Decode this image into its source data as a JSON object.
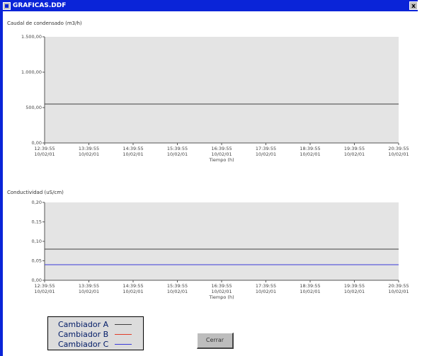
{
  "window": {
    "title": "GRAFICAS.DDF",
    "close_label": "x"
  },
  "colors": {
    "title_bar": "#0a24d8",
    "plot_bg": "#e4e4e4",
    "cambiador_a": "#404040",
    "cambiador_b": "#e03c28",
    "cambiador_c": "#3a3ad8"
  },
  "chart_data": [
    {
      "type": "line",
      "title": "Caudal de condensado (m3/h)",
      "xlabel": "Tiempo (h)",
      "ylabel": "",
      "ylim": [
        0,
        1500
      ],
      "yticks": [
        "0,00",
        "500,00",
        "1.000,00",
        "1.500,00"
      ],
      "ytick_values": [
        0,
        500,
        1000,
        1500
      ],
      "x": [
        "12:39:55",
        "13:39:55",
        "14:39:55",
        "15:39:55",
        "16:39:55",
        "17:39:55",
        "18:39:55",
        "19:39:55",
        "20:39:55"
      ],
      "xdate": "10/02/01",
      "grid": false,
      "series": [
        {
          "name": "Cambiador A",
          "values": [
            550,
            550,
            550,
            550,
            550,
            550,
            550,
            550,
            550
          ]
        }
      ]
    },
    {
      "type": "line",
      "title": "Conductividad (uS/cm)",
      "xlabel": "Tiempo (h)",
      "ylabel": "",
      "ylim": [
        0,
        0.2
      ],
      "yticks": [
        "0,00",
        "0,05",
        "0,10",
        "0,15",
        "0,20"
      ],
      "ytick_values": [
        0,
        0.05,
        0.1,
        0.15,
        0.2
      ],
      "x": [
        "12:39:55",
        "13:39:55",
        "14:39:55",
        "15:39:55",
        "16:39:55",
        "17:39:55",
        "18:39:55",
        "19:39:55",
        "20:39:55"
      ],
      "xdate": "10/02/01",
      "grid": false,
      "series": [
        {
          "name": "Cambiador A",
          "values": [
            0.08,
            0.08,
            0.08,
            0.08,
            0.08,
            0.08,
            0.08,
            0.08,
            0.08
          ]
        },
        {
          "name": "Cambiador C",
          "values": [
            0.04,
            0.04,
            0.04,
            0.04,
            0.04,
            0.04,
            0.04,
            0.04,
            0.04
          ]
        }
      ]
    }
  ],
  "legend": {
    "items": [
      {
        "label": "Cambiador A",
        "color": "#404040"
      },
      {
        "label": "Cambiador B",
        "color": "#e03c28"
      },
      {
        "label": "Cambiador C",
        "color": "#3a3ad8"
      }
    ]
  },
  "buttons": {
    "close_label": "Cerrar"
  }
}
